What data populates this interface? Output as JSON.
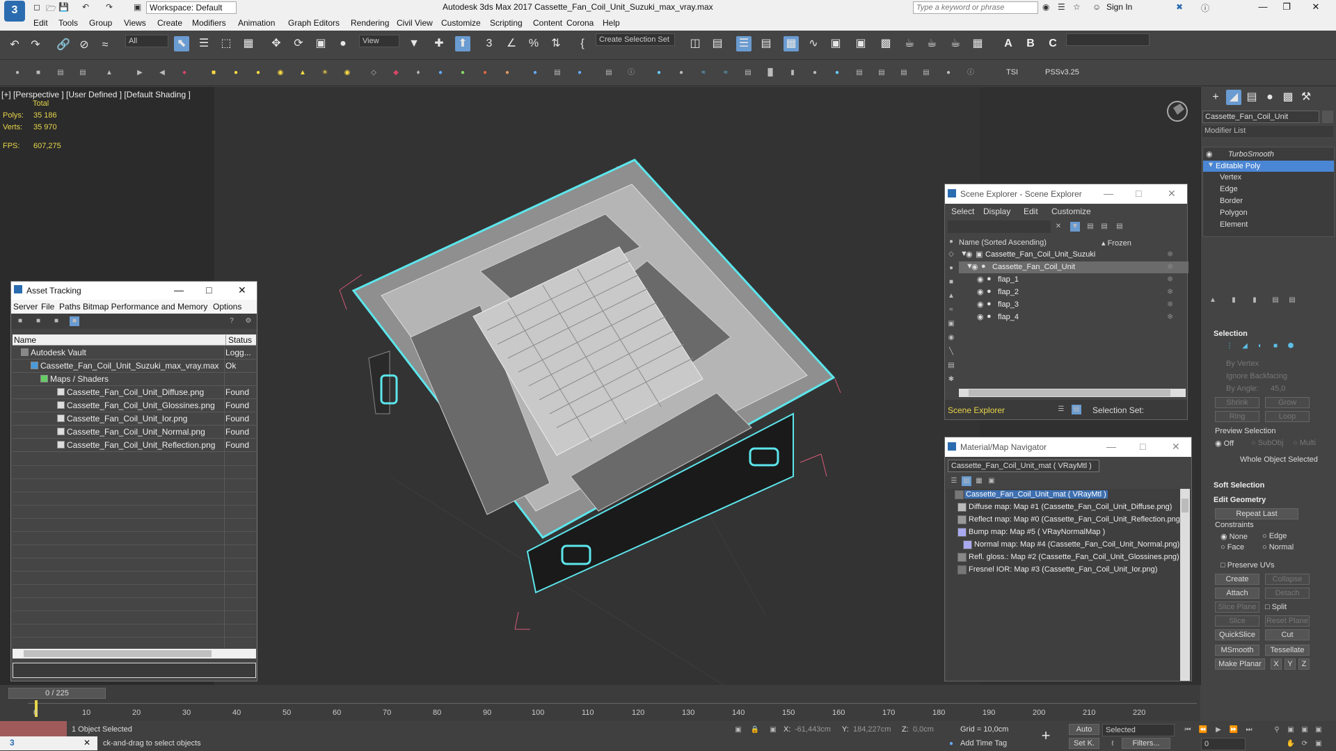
{
  "app": {
    "logo": "3",
    "workspace": "Workspace: Default",
    "title": "Autodesk 3ds Max 2017     Cassette_Fan_Coil_Unit_Suzuki_max_vray.max",
    "search_placeholder": "Type a keyword or phrase",
    "sign_in": "Sign In"
  },
  "menu": [
    "Edit",
    "Tools",
    "Group",
    "Views",
    "Create",
    "Modifiers",
    "Animation",
    "Graph Editors",
    "Rendering",
    "Civil View",
    "Customize",
    "Scripting",
    "Content",
    "Corona",
    "Help"
  ],
  "toolbar": {
    "filter": "All",
    "view": "View",
    "selection_set": "Create Selection Set",
    "tsi": "TSI",
    "pss": "PSSv3.25"
  },
  "viewport": {
    "label": "[+] [Perspective ]  [User Defined ]  [Default Shading ]",
    "stats_total": "Total",
    "polys_label": "Polys:",
    "polys": "35 186",
    "verts_label": "Verts:",
    "verts": "35 970",
    "fps_label": "FPS:",
    "fps": "607,275"
  },
  "asset_tracking": {
    "title": "Asset Tracking",
    "menu": [
      "Server",
      "File",
      "Paths",
      "Bitmap Performance and Memory",
      "Options"
    ],
    "col_name": "Name",
    "col_status": "Status",
    "rows": [
      {
        "name": "Autodesk Vault",
        "status": "Logg..."
      },
      {
        "name": "Cassette_Fan_Coil_Unit_Suzuki_max_vray.max",
        "status": "Ok"
      },
      {
        "name": "Maps / Shaders",
        "status": ""
      },
      {
        "name": "Cassette_Fan_Coil_Unit_Diffuse.png",
        "status": "Found"
      },
      {
        "name": "Cassette_Fan_Coil_Unit_Glossines.png",
        "status": "Found"
      },
      {
        "name": "Cassette_Fan_Coil_Unit_Ior.png",
        "status": "Found"
      },
      {
        "name": "Cassette_Fan_Coil_Unit_Normal.png",
        "status": "Found"
      },
      {
        "name": "Cassette_Fan_Coil_Unit_Reflection.png",
        "status": "Found"
      }
    ]
  },
  "scene_explorer": {
    "title": "Scene Explorer - Scene Explorer",
    "menu": [
      "Select",
      "Display",
      "Edit",
      "Customize"
    ],
    "col_name": "Name (Sorted Ascending)",
    "col_frozen": "▴ Frozen",
    "items": [
      {
        "name": "Cassette_Fan_Coil_Unit_Suzuki"
      },
      {
        "name": "Cassette_Fan_Coil_Unit"
      },
      {
        "name": "flap_1"
      },
      {
        "name": "flap_2"
      },
      {
        "name": "flap_3"
      },
      {
        "name": "flap_4"
      }
    ],
    "footer": "Scene Explorer",
    "selection_set": "Selection Set:"
  },
  "material_navigator": {
    "title": "Material/Map Navigator",
    "current": "Cassette_Fan_Coil_Unit_mat  ( VRayMtl )",
    "root": "Cassette_Fan_Coil_Unit_mat  ( VRayMtl )",
    "maps": [
      "Diffuse map: Map #1 (Cassette_Fan_Coil_Unit_Diffuse.png)",
      "Reflect map: Map #0 (Cassette_Fan_Coil_Unit_Reflection.png)",
      "Bump map: Map #5  ( VRayNormalMap )",
      "Normal map: Map #4 (Cassette_Fan_Coil_Unit_Normal.png)",
      "Refl. gloss.: Map #2 (Cassette_Fan_Coil_Unit_Glossines.png)",
      "Fresnel IOR: Map #3 (Cassette_Fan_Coil_Unit_Ior.png)"
    ]
  },
  "command_panel": {
    "object_name": "Cassette_Fan_Coil_Unit",
    "modifier_list": "Modifier List",
    "stack": [
      "TurboSmooth",
      "Editable Poly",
      "Vertex",
      "Edge",
      "Border",
      "Polygon",
      "Element"
    ],
    "selection_header": "Selection",
    "by_vertex": "By Vertex",
    "ignore_backfacing": "Ignore Backfacing",
    "by_angle": "By Angle:",
    "by_angle_value": "45,0",
    "shrink": "Shrink",
    "grow": "Grow",
    "ring": "Ring",
    "loop": "Loop",
    "preview_selection": "Preview Selection",
    "off": "Off",
    "subobj": "SubObj",
    "multi": "Multi",
    "whole_object": "Whole Object Selected",
    "soft_selection": "Soft Selection",
    "edit_geometry": "Edit Geometry",
    "repeat_last": "Repeat Last",
    "constraints": "Constraints",
    "none": "None",
    "edge": "Edge",
    "face": "Face",
    "normal": "Normal",
    "preserve_uvs": "Preserve UVs",
    "create": "Create",
    "collapse": "Collapse",
    "attach": "Attach",
    "detach": "Detach",
    "slice_plane": "Slice Plane",
    "split": "Split",
    "slice": "Slice",
    "reset_plane": "Reset Plane",
    "quickslice": "QuickSlice",
    "cut": "Cut",
    "msmooth": "MSmooth",
    "tessellate": "Tessellate",
    "make_planar": "Make Planar",
    "x": "X",
    "y": "Y",
    "z": "Z"
  },
  "timeline": {
    "frame": "0 / 225",
    "ticks": [
      "0",
      "10",
      "20",
      "30",
      "40",
      "50",
      "60",
      "70",
      "80",
      "90",
      "100",
      "110",
      "120",
      "130",
      "140",
      "150",
      "160",
      "170",
      "180",
      "190",
      "200",
      "210",
      "220"
    ]
  },
  "status": {
    "selected": "1 Object Selected",
    "prompt": "ck-and-drag to select objects",
    "x_label": "X:",
    "x": "-61,443cm",
    "y_label": "Y:",
    "y": "184,227cm",
    "z_label": "Z:",
    "z": "0,0cm",
    "grid": "Grid = 10,0cm",
    "add_time_tag": "Add Time Tag",
    "auto": "Auto",
    "set_k": "Set K.",
    "selected_dd": "Selected",
    "filters": "Filters...",
    "frame": "0"
  },
  "colors": {
    "selection_cyan": "#5ce6ec",
    "accent_blue": "#6a9bd1",
    "stats_yellow": "#e8d64a"
  }
}
